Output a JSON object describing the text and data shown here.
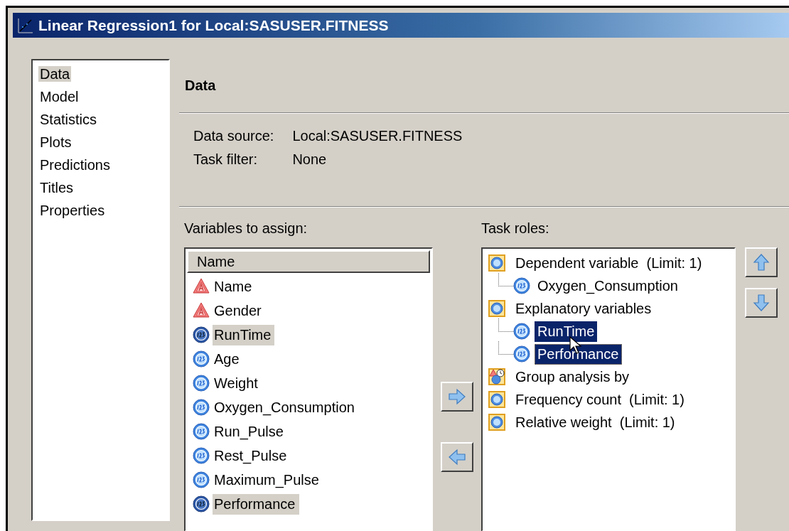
{
  "window": {
    "title": "Linear Regression1 for Local:SASUSER.FITNESS"
  },
  "nav": [
    {
      "label": "Data",
      "selected": true
    },
    {
      "label": "Model",
      "selected": false
    },
    {
      "label": "Statistics",
      "selected": false
    },
    {
      "label": "Plots",
      "selected": false
    },
    {
      "label": "Predictions",
      "selected": false
    },
    {
      "label": "Titles",
      "selected": false
    },
    {
      "label": "Properties",
      "selected": false
    }
  ],
  "section_title": "Data",
  "info": [
    {
      "label": "Data source:",
      "value": "Local:SASUSER.FITNESS"
    },
    {
      "label": "Task filter:",
      "value": "None"
    }
  ],
  "variables": {
    "label": "Variables to assign:",
    "column": "Name",
    "items": [
      {
        "name": "Name",
        "kind": "character",
        "selected": false
      },
      {
        "name": "Gender",
        "kind": "character",
        "selected": false
      },
      {
        "name": "RunTime",
        "kind": "numeric",
        "selected": true
      },
      {
        "name": "Age",
        "kind": "numeric",
        "selected": false
      },
      {
        "name": "Weight",
        "kind": "numeric",
        "selected": false
      },
      {
        "name": "Oxygen_Consumption",
        "kind": "numeric",
        "selected": false
      },
      {
        "name": "Run_Pulse",
        "kind": "numeric",
        "selected": false
      },
      {
        "name": "Rest_Pulse",
        "kind": "numeric",
        "selected": false
      },
      {
        "name": "Maximum_Pulse",
        "kind": "numeric",
        "selected": false
      },
      {
        "name": "Performance",
        "kind": "numeric",
        "selected": true
      }
    ]
  },
  "task_roles": {
    "label": "Task roles:",
    "roles": [
      {
        "name": "Dependent variable  (Limit: 1)",
        "kind": "numeric",
        "children": [
          {
            "name": "Oxygen_Consumption",
            "selected": false,
            "focused": false
          }
        ]
      },
      {
        "name": "Explanatory variables",
        "kind": "numeric",
        "children": [
          {
            "name": "RunTime",
            "selected": true,
            "focused": false
          },
          {
            "name": "Performance",
            "selected": true,
            "focused": true
          }
        ]
      },
      {
        "name": "Group analysis by",
        "kind": "group"
      },
      {
        "name": "Frequency count  (Limit: 1)",
        "kind": "numeric"
      },
      {
        "name": "Relative weight  (Limit: 1)",
        "kind": "numeric"
      }
    ]
  }
}
